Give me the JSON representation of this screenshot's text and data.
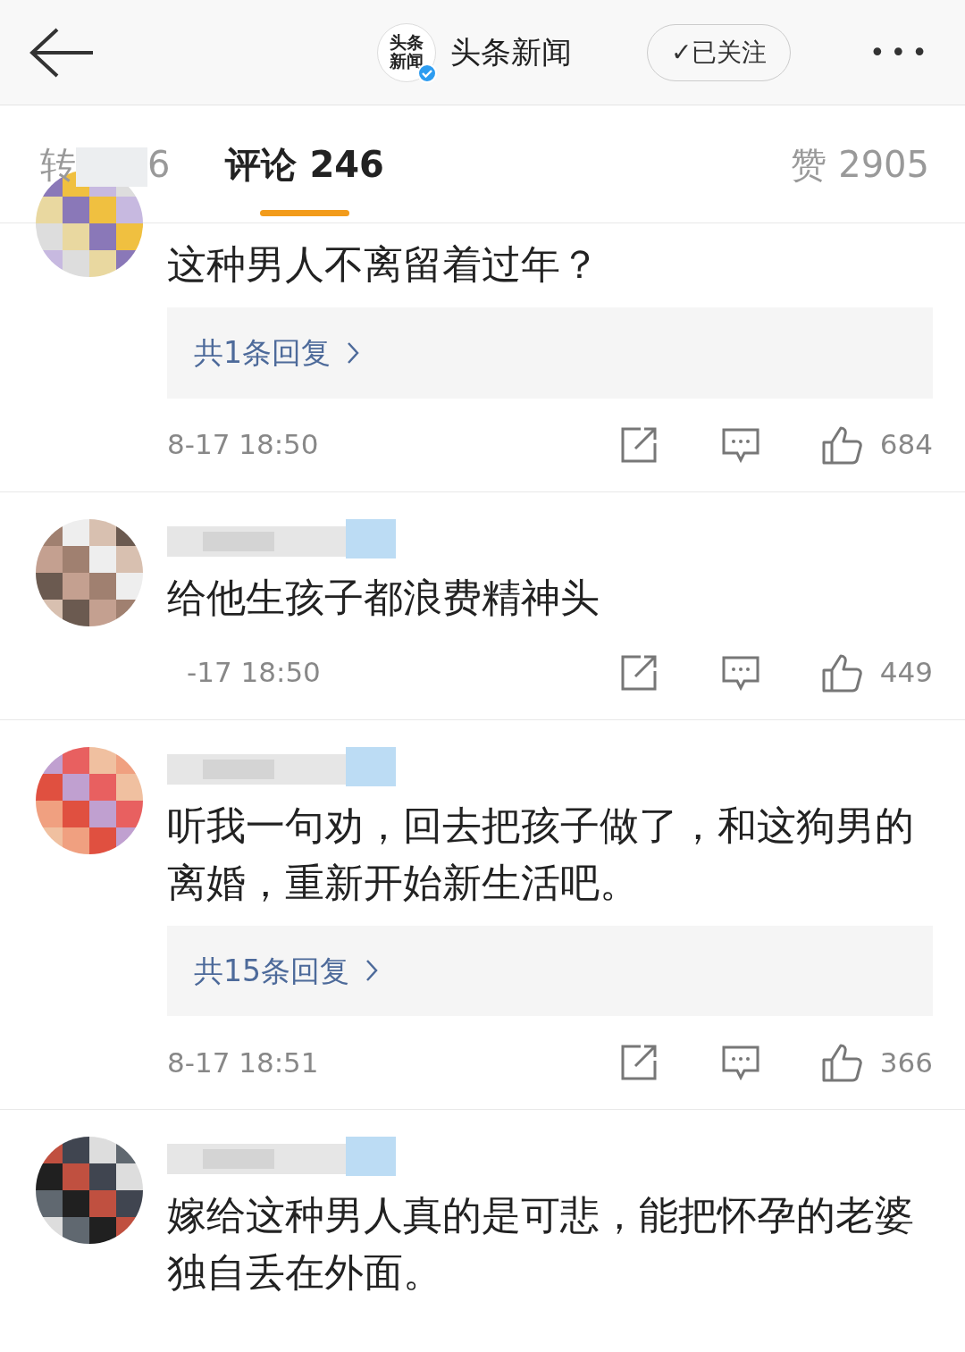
{
  "header": {
    "logo_text": "头条新闻",
    "account": "头条新闻",
    "verified": true,
    "follow_button": "✓已关注",
    "more": "•••"
  },
  "tabs": [
    {
      "label": "转",
      "count": "6",
      "selected": false,
      "obscured": true
    },
    {
      "label": "评论",
      "count": "246",
      "selected": true
    },
    {
      "label": "赞",
      "count": "2905",
      "selected": false
    }
  ],
  "comments": [
    {
      "name_blurred": false,
      "text": "这种男人不离留着过年？",
      "replies": "共1条回复",
      "time": "8-17 18:50",
      "likes": "684"
    },
    {
      "name_blurred": true,
      "text": "给他生孩子都浪费精神头",
      "time": "-17 18:50",
      "likes": "449",
      "time_obscured": true
    },
    {
      "name_blurred": true,
      "text": "听我一句劝，回去把孩子做了，和这狗男的离婚，重新开始新生活吧。",
      "replies": "共15条回复",
      "time": "8-17 18:51",
      "likes": "366"
    },
    {
      "name_blurred": true,
      "text": "嫁给这种男人真的是可悲，能把怀孕的老婆独自丢在外面。"
    }
  ]
}
